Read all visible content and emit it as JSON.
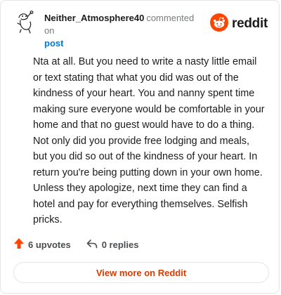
{
  "header": {
    "author": "Neither_Atmosphere40",
    "action": "commented on",
    "post_link": "post",
    "brand": "reddit"
  },
  "comment": {
    "text": "Nta at all. But you need to write a nasty little email or text stating that what you did was out of the kindness of your heart. You and nanny spent time making sure everyone would be comfortable in your home and that no guest would have to do a thing. Not only did you provide free lodging and meals, but you did so out of the kindness of your heart. In return you're being putting down in your own home. Unless they apologize, next time they can find a hotel and pay for everything themselves. Selfish pricks."
  },
  "footer": {
    "upvotes": "6 upvotes",
    "replies": "0 replies"
  },
  "cta": {
    "label": "View more on Reddit"
  },
  "icons": {
    "avatar": "snoo-avatar-icon",
    "brand": "reddit-logo-icon",
    "upvote": "upvote-arrow-icon",
    "reply": "reply-arrow-icon"
  },
  "colors": {
    "brand_orange": "#ff4500",
    "link_blue": "#0079d3",
    "cta_text": "#d93a00"
  }
}
